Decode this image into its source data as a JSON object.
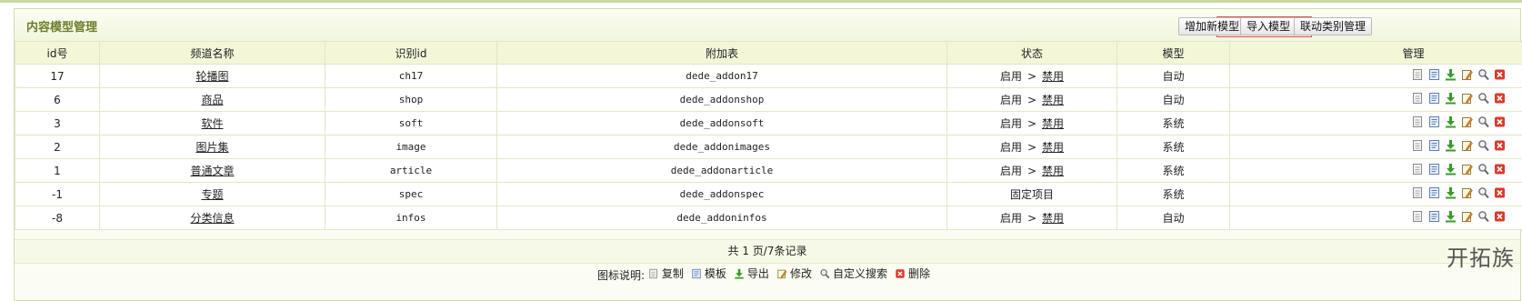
{
  "header": {
    "title": "内容模型管理",
    "buttons": {
      "add": "增加新模型",
      "import": "导入模型",
      "link_category": "联动类别管理"
    }
  },
  "table": {
    "columns": [
      "id号",
      "频道名称",
      "识别id",
      "附加表",
      "状态",
      "模型",
      "管理"
    ],
    "rows": [
      {
        "id": "17",
        "name": "轮播图",
        "nid": "ch17",
        "addtable": "dede_addon17",
        "status_on": "启用",
        "status_sep": ">",
        "status_action": "禁用",
        "model": "自动"
      },
      {
        "id": "6",
        "name": "商品",
        "nid": "shop",
        "addtable": "dede_addonshop",
        "status_on": "启用",
        "status_sep": ">",
        "status_action": "禁用",
        "model": "自动"
      },
      {
        "id": "3",
        "name": "软件",
        "nid": "soft",
        "addtable": "dede_addonsoft",
        "status_on": "启用",
        "status_sep": ">",
        "status_action": "禁用",
        "model": "系统"
      },
      {
        "id": "2",
        "name": "图片集",
        "nid": "image",
        "addtable": "dede_addonimages",
        "status_on": "启用",
        "status_sep": ">",
        "status_action": "禁用",
        "model": "系统"
      },
      {
        "id": "1",
        "name": "普通文章",
        "nid": "article",
        "addtable": "dede_addonarticle",
        "status_on": "启用",
        "status_sep": ">",
        "status_action": "禁用",
        "model": "系统"
      },
      {
        "id": "-1",
        "name": "专题",
        "nid": "spec",
        "addtable": "dede_addonspec",
        "status_fixed": "固定项目",
        "model": "系统"
      },
      {
        "id": "-8",
        "name": "分类信息",
        "nid": "infos",
        "addtable": "dede_addoninfos",
        "status_on": "启用",
        "status_sep": ">",
        "status_action": "禁用",
        "model": "自动"
      }
    ]
  },
  "summary": "共 1 页/7条记录",
  "legend": {
    "prefix": "图标说明:",
    "items": [
      "复制",
      "模板",
      "导出",
      "修改",
      "自定义搜索",
      "删除"
    ]
  },
  "watermark": "开拓族",
  "icons": [
    "copy-icon",
    "template-icon",
    "export-icon",
    "edit-icon",
    "search-icon",
    "delete-icon"
  ],
  "colors": {
    "header_bg": "#f3f7d8",
    "title": "#6d7e2c",
    "border": "#dfe7c8",
    "delete": "#d93b2b",
    "export": "#3a9a2a"
  }
}
